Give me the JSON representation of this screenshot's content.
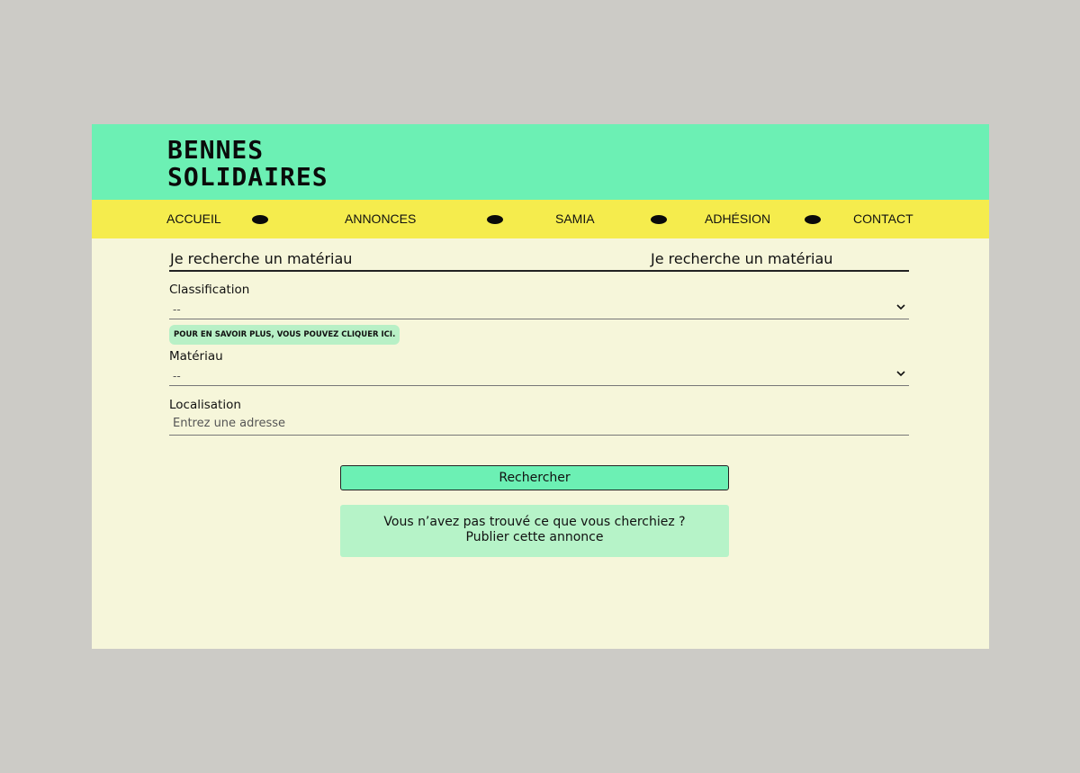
{
  "header": {
    "logo_line1": "BENNES",
    "logo_line2": "SOLIDAIRES"
  },
  "nav": {
    "items": [
      {
        "label": "ACCUEIL"
      },
      {
        "label": "ANNONCES"
      },
      {
        "label": "SAMIA"
      },
      {
        "label": "ADHÉSION"
      },
      {
        "label": "CONTACT"
      }
    ]
  },
  "search": {
    "title_left": "Je recherche un matériau",
    "title_right": "Je recherche un matériau",
    "classification_label": "Classification",
    "classification_value": "--",
    "info_link": "POUR EN SAVOIR PLUS, VOUS POUVEZ CLIQUER ICI.",
    "materiau_label": "Matériau",
    "materiau_value": "--",
    "localisation_label": "Localisation",
    "localisation_placeholder": "Entrez une adresse",
    "search_button": "Rechercher",
    "notfound_line1": "Vous n’avez pas trouvé ce que vous cherchiez ?",
    "notfound_line2": "Publier cette annonce"
  },
  "colors": {
    "header_bg": "#6cf0b4",
    "nav_bg": "#f5ec4d",
    "page_bg": "#f6f6da",
    "pill_bg": "#b8f0c6"
  }
}
